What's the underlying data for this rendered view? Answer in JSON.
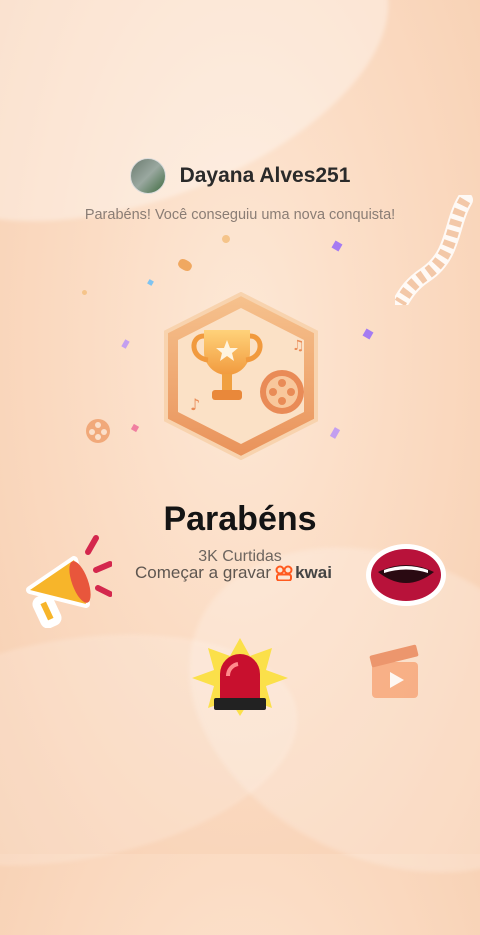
{
  "header": {
    "username": "Dayana Alves251"
  },
  "message": "Parabéns! Você conseguiu uma nova conquista!",
  "achievement": {
    "title": "Parabéns",
    "likes": "3K Curtidas",
    "record_label": "Começar a gravar",
    "brand": "kwai"
  },
  "colors": {
    "accent": "#f0a040",
    "brand": "#ff5a1f",
    "background": "#fbdcc4"
  },
  "icons": [
    "trophy-icon",
    "film-reel-icon",
    "megaphone-icon",
    "lips-icon",
    "siren-icon",
    "clapperboard-icon"
  ]
}
